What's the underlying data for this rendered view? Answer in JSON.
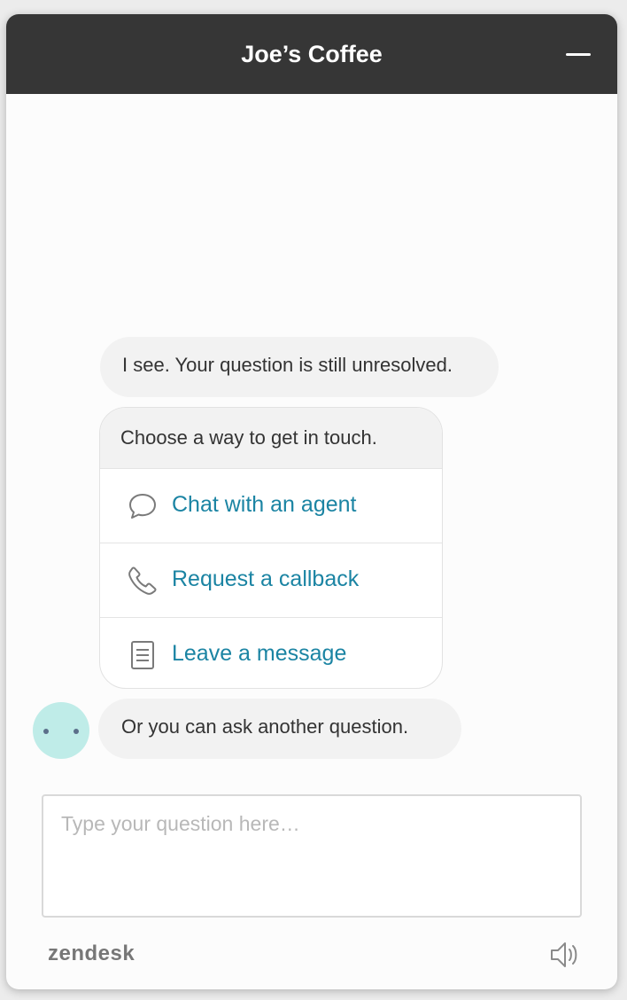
{
  "header": {
    "title": "Joe’s Coffee",
    "minimize_icon": "minimize-icon"
  },
  "messages": [
    {
      "text": "I see. Your question is still unresolved."
    },
    {
      "text": "Or you can ask another question."
    }
  ],
  "contact_options": {
    "heading": "Choose a way to get in touch.",
    "items": [
      {
        "label": "Chat with an agent",
        "icon": "chat-bubble-icon"
      },
      {
        "label": "Request a callback",
        "icon": "phone-icon"
      },
      {
        "label": "Leave a message",
        "icon": "document-icon"
      }
    ]
  },
  "input": {
    "placeholder": "Type your question here…",
    "value": ""
  },
  "footer": {
    "brand": "zendesk",
    "sound_icon": "speaker-icon"
  },
  "colors": {
    "header_bg": "#363636",
    "link": "#1b84a3",
    "bubble_bg": "#f2f2f2",
    "avatar_bg": "#bfece8"
  }
}
